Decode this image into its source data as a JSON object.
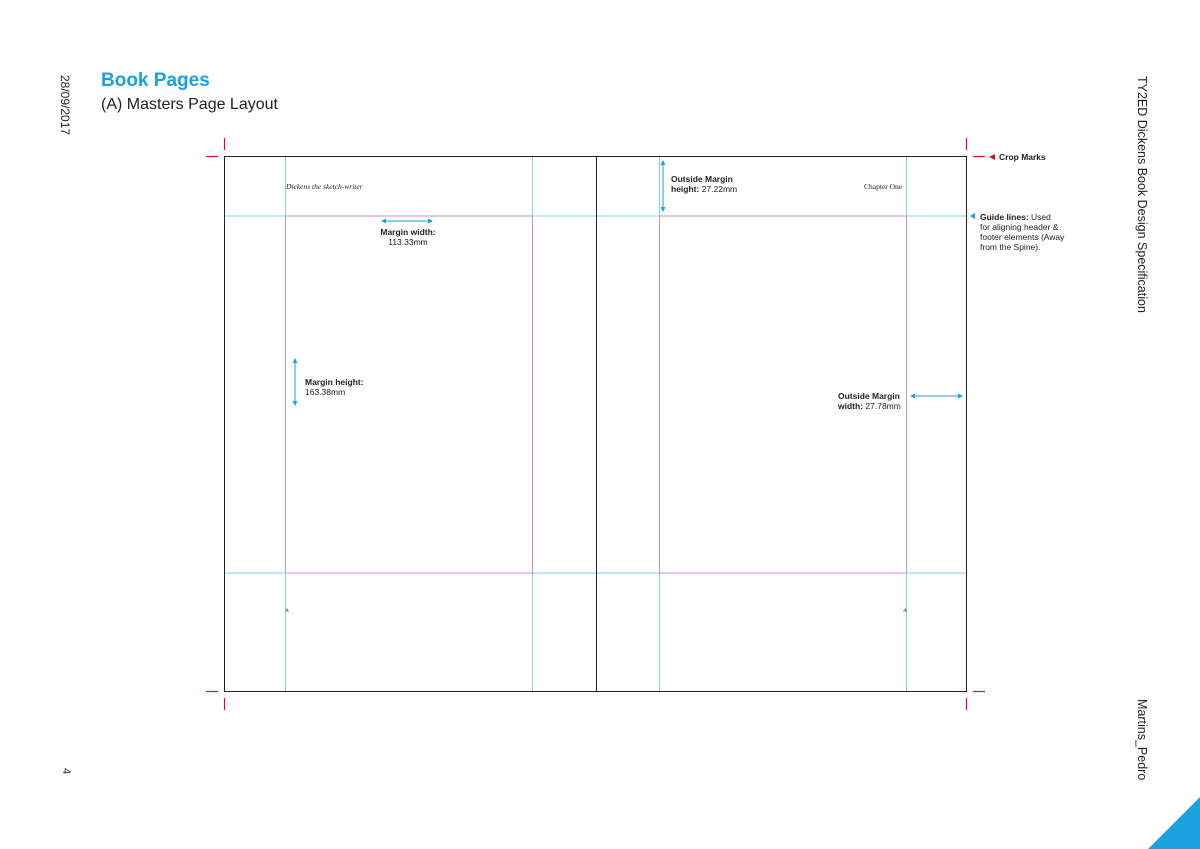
{
  "header": {
    "title": "Book Pages",
    "subtitle": "(A) Masters Page Layout"
  },
  "side": {
    "date": "28/09/2017",
    "spec_title": "TY2ED Dickens Book Design Specification",
    "author": "Martins_Pedro",
    "page_number": "4"
  },
  "spread": {
    "left_running_head": "Dickens the sketch-writer",
    "right_running_head": "Chapter One",
    "left_folio": "A",
    "right_folio": "A"
  },
  "annotations": {
    "crop_marks": "Crop Marks",
    "guide_lines_bold": "Guide lines:",
    "guide_lines_text_1": " Used",
    "guide_lines_text_2": "for aligning header &",
    "guide_lines_text_3": "footer elements (Away",
    "guide_lines_text_4": "from the Spine).",
    "margin_width_label": "Margin width:",
    "margin_width_value": "113.33mm",
    "margin_height_label": "Margin height:",
    "margin_height_value": "163.38mm",
    "outside_margin_height_label_1": "Outside Margin",
    "outside_margin_height_label_2": "height:",
    "outside_margin_height_value": "27.22mm",
    "outside_margin_width_label_1": "Outside Margin",
    "outside_margin_width_label_2": "width:",
    "outside_margin_width_value": "27.78mm"
  },
  "colors": {
    "accent": "#1aa1de",
    "guide": "#7fd6ea",
    "margin": "#c38fd0",
    "crop": "#d0101a",
    "page_border": "#222222"
  }
}
